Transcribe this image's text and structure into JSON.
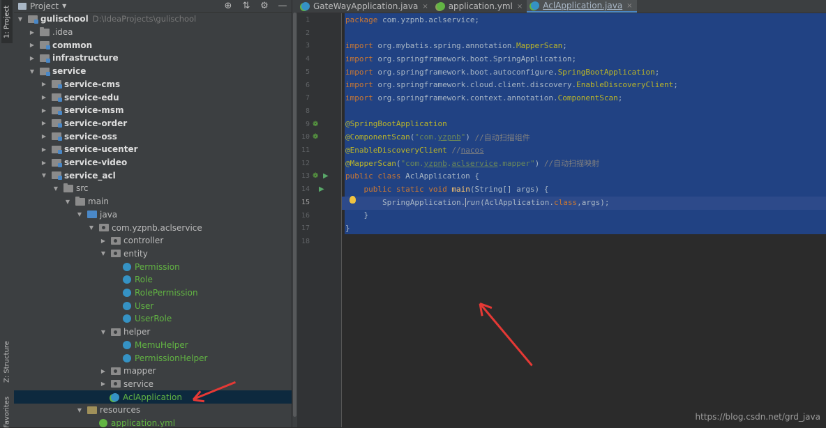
{
  "left_strip": {
    "project_tab": "1: Project",
    "structure_tab": "Z: Structure",
    "favorites_tab": "Favorites"
  },
  "project_panel": {
    "title": "Project",
    "tool_icons": [
      "globe-icon",
      "collapse-icon",
      "gear-icon",
      "minimize-icon"
    ],
    "tree": [
      {
        "label": "gulischool",
        "path": "D:\\IdeaProjects\\gulischool",
        "depth": 0,
        "arrow": "down",
        "icon": "module",
        "style": "bold"
      },
      {
        "label": ".idea",
        "depth": 1,
        "arrow": "right",
        "icon": "folder",
        "style": "normal"
      },
      {
        "label": "common",
        "depth": 1,
        "arrow": "right",
        "icon": "module",
        "style": "bold"
      },
      {
        "label": "infrastructure",
        "depth": 1,
        "arrow": "right",
        "icon": "module",
        "style": "bold"
      },
      {
        "label": "service",
        "depth": 1,
        "arrow": "down",
        "icon": "module",
        "style": "bold"
      },
      {
        "label": "service-cms",
        "depth": 2,
        "arrow": "right",
        "icon": "module",
        "style": "bold"
      },
      {
        "label": "service-edu",
        "depth": 2,
        "arrow": "right",
        "icon": "module",
        "style": "bold"
      },
      {
        "label": "service-msm",
        "depth": 2,
        "arrow": "right",
        "icon": "module",
        "style": "bold"
      },
      {
        "label": "service-order",
        "depth": 2,
        "arrow": "right",
        "icon": "module",
        "style": "bold"
      },
      {
        "label": "service-oss",
        "depth": 2,
        "arrow": "right",
        "icon": "module",
        "style": "bold"
      },
      {
        "label": "service-ucenter",
        "depth": 2,
        "arrow": "right",
        "icon": "module",
        "style": "bold"
      },
      {
        "label": "service-video",
        "depth": 2,
        "arrow": "right",
        "icon": "module",
        "style": "bold"
      },
      {
        "label": "service_acl",
        "depth": 2,
        "arrow": "down",
        "icon": "module",
        "style": "bold"
      },
      {
        "label": "src",
        "depth": 3,
        "arrow": "down",
        "icon": "folder",
        "style": "normal"
      },
      {
        "label": "main",
        "depth": 4,
        "arrow": "down",
        "icon": "folder",
        "style": "normal"
      },
      {
        "label": "java",
        "depth": 5,
        "arrow": "down",
        "icon": "src",
        "style": "normal"
      },
      {
        "label": "com.yzpnb.aclservice",
        "depth": 6,
        "arrow": "down",
        "icon": "pkg",
        "style": "normal"
      },
      {
        "label": "controller",
        "depth": 7,
        "arrow": "right",
        "icon": "pkg",
        "style": "normal"
      },
      {
        "label": "entity",
        "depth": 7,
        "arrow": "down",
        "icon": "pkg",
        "style": "normal"
      },
      {
        "label": "Permission",
        "depth": 8,
        "arrow": "none",
        "icon": "class",
        "style": "green"
      },
      {
        "label": "Role",
        "depth": 8,
        "arrow": "none",
        "icon": "class",
        "style": "green"
      },
      {
        "label": "RolePermission",
        "depth": 8,
        "arrow": "none",
        "icon": "class",
        "style": "green"
      },
      {
        "label": "User",
        "depth": 8,
        "arrow": "none",
        "icon": "class",
        "style": "green"
      },
      {
        "label": "UserRole",
        "depth": 8,
        "arrow": "none",
        "icon": "class",
        "style": "green"
      },
      {
        "label": "helper",
        "depth": 7,
        "arrow": "down",
        "icon": "pkg",
        "style": "normal"
      },
      {
        "label": "MemuHelper",
        "depth": 8,
        "arrow": "none",
        "icon": "class",
        "style": "green"
      },
      {
        "label": "PermissionHelper",
        "depth": 8,
        "arrow": "none",
        "icon": "class",
        "style": "green"
      },
      {
        "label": "mapper",
        "depth": 7,
        "arrow": "right",
        "icon": "pkg",
        "style": "normal"
      },
      {
        "label": "service",
        "depth": 7,
        "arrow": "right",
        "icon": "pkg",
        "style": "normal"
      },
      {
        "label": "AclApplication",
        "depth": 7,
        "arrow": "none",
        "icon": "spring-class",
        "style": "green",
        "selected": true
      },
      {
        "label": "resources",
        "depth": 5,
        "arrow": "down",
        "icon": "res",
        "style": "normal"
      },
      {
        "label": "application.yml",
        "depth": 6,
        "arrow": "none",
        "icon": "yml",
        "style": "green"
      }
    ]
  },
  "editor": {
    "tabs": [
      {
        "label": "GateWayApplication.java",
        "icon": "java",
        "active": false
      },
      {
        "label": "application.yml",
        "icon": "yml",
        "active": false
      },
      {
        "label": "AclApplication.java",
        "icon": "java",
        "active": true
      }
    ],
    "current_line": 15,
    "line_numbers": [
      "1",
      "2",
      "3",
      "4",
      "5",
      "6",
      "7",
      "8",
      "9",
      "10",
      "11",
      "12",
      "13",
      "14",
      "15",
      "16",
      "17",
      "18"
    ],
    "code_lines": [
      [
        [
          "kw",
          "package "
        ],
        [
          "",
          "com.yzpnb.aclservice;"
        ]
      ],
      [],
      [
        [
          "kw",
          "import "
        ],
        [
          "",
          "org.mybatis.spring.annotation."
        ],
        [
          "an",
          "MapperScan"
        ],
        [
          "",
          ";"
        ]
      ],
      [
        [
          "kw",
          "import "
        ],
        [
          "",
          "org.springframework.boot.SpringApplication;"
        ]
      ],
      [
        [
          "kw",
          "import "
        ],
        [
          "",
          "org.springframework.boot.autoconfigure."
        ],
        [
          "an",
          "SpringBootApplication"
        ],
        [
          "",
          ";"
        ]
      ],
      [
        [
          "kw",
          "import "
        ],
        [
          "",
          "org.springframework.cloud.client.discovery."
        ],
        [
          "an",
          "EnableDiscoveryClient"
        ],
        [
          "",
          ";"
        ]
      ],
      [
        [
          "kw",
          "import "
        ],
        [
          "",
          "org.springframework.context.annotation."
        ],
        [
          "an",
          "ComponentScan"
        ],
        [
          "",
          ";"
        ]
      ],
      [],
      [
        [
          "an",
          "@SpringBootApplication"
        ]
      ],
      [
        [
          "an",
          "@ComponentScan"
        ],
        [
          "",
          "("
        ],
        [
          "st",
          "\"com."
        ],
        [
          "st u",
          "yzpnb"
        ],
        [
          "st",
          "\""
        ],
        [
          "",
          ") "
        ],
        [
          "cm",
          "//自动扫描组件"
        ]
      ],
      [
        [
          "an",
          "@EnableDiscoveryClient "
        ],
        [
          "cm",
          "//"
        ],
        [
          "cm u",
          "nacos"
        ]
      ],
      [
        [
          "an",
          "@MapperScan"
        ],
        [
          "",
          "("
        ],
        [
          "st",
          "\"com."
        ],
        [
          "st u",
          "yzpnb"
        ],
        [
          "st",
          "."
        ],
        [
          "st u",
          "aclservice"
        ],
        [
          "st",
          ".mapper\""
        ],
        [
          "",
          ") "
        ],
        [
          "cm",
          "//自动扫描映射"
        ]
      ],
      [
        [
          "kw",
          "public class "
        ],
        [
          "",
          "AclApplication {"
        ]
      ],
      [
        [
          "",
          "    "
        ],
        [
          "kw",
          "public static void "
        ],
        [
          "fn",
          "main"
        ],
        [
          "",
          "(String[] args) {"
        ]
      ],
      [
        [
          "",
          "        SpringApplication."
        ],
        [
          "caret",
          ""
        ],
        [
          "it",
          "run"
        ],
        [
          "",
          "(AclApplication."
        ],
        [
          "kw",
          "class"
        ],
        [
          "",
          ",args);"
        ]
      ],
      [
        [
          "",
          "    }"
        ]
      ],
      [
        [
          "",
          "}"
        ]
      ],
      []
    ]
  },
  "watermark": "https://blog.csdn.net/grd_java",
  "colors": {
    "selection": "#214283",
    "keyword": "#cc7832",
    "annotation": "#bbb529",
    "string": "#6a8759",
    "comment": "#808080",
    "annotation_arrow": "#e53935"
  }
}
